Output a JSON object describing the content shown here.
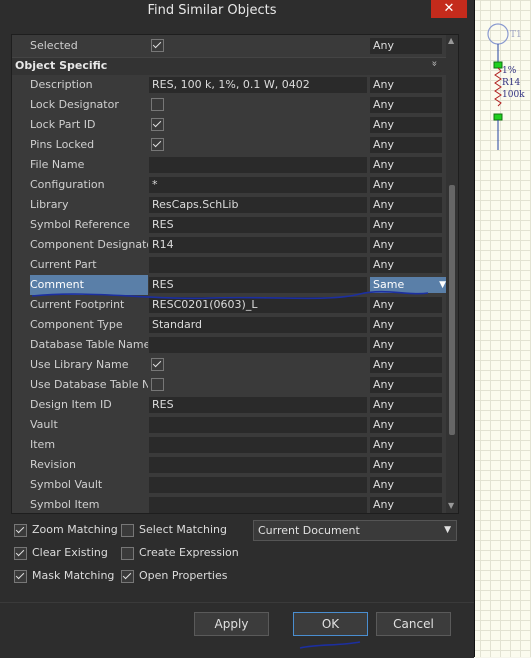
{
  "dialog": {
    "title": "Find Similar Objects",
    "close_glyph": "✕"
  },
  "top_row": {
    "name": "Selected",
    "checked": true,
    "op": "Any"
  },
  "section": {
    "label": "Object Specific",
    "chevron": "»"
  },
  "rows": [
    {
      "name": "Description",
      "value": "RES, 100 k, 1%, 0.1 W, 0402",
      "op": "Any",
      "checkbox": false
    },
    {
      "name": "Lock Designator",
      "value": "",
      "op": "Any",
      "checkbox": true,
      "checked": false
    },
    {
      "name": "Lock Part ID",
      "value": "",
      "op": "Any",
      "checkbox": true,
      "checked": true
    },
    {
      "name": "Pins Locked",
      "value": "",
      "op": "Any",
      "checkbox": true,
      "checked": true
    },
    {
      "name": "File Name",
      "value": "",
      "op": "Any",
      "checkbox": false
    },
    {
      "name": "Configuration",
      "value": "*",
      "op": "Any",
      "checkbox": false
    },
    {
      "name": "Library",
      "value": "ResCaps.SchLib",
      "op": "Any",
      "checkbox": false
    },
    {
      "name": "Symbol Reference",
      "value": "RES",
      "op": "Any",
      "checkbox": false
    },
    {
      "name": "Component Designator",
      "value": "R14",
      "op": "Any",
      "checkbox": false
    },
    {
      "name": "Current Part",
      "value": "",
      "op": "Any",
      "checkbox": false
    },
    {
      "name": "Comment",
      "value": "RES",
      "op": "Same",
      "checkbox": false,
      "selected": true
    },
    {
      "name": "Current Footprint",
      "value": "RESC0201(0603)_L",
      "op": "Any",
      "checkbox": false
    },
    {
      "name": "Component Type",
      "value": "Standard",
      "op": "Any",
      "checkbox": false
    },
    {
      "name": "Database Table Name",
      "value": "",
      "op": "Any",
      "checkbox": false
    },
    {
      "name": "Use Library Name",
      "value": "",
      "op": "Any",
      "checkbox": true,
      "checked": true
    },
    {
      "name": "Use Database Table Name",
      "value": "",
      "op": "Any",
      "checkbox": true,
      "checked": false
    },
    {
      "name": "Design Item ID",
      "value": "RES",
      "op": "Any",
      "checkbox": false
    },
    {
      "name": "Vault",
      "value": "",
      "op": "Any",
      "checkbox": false
    },
    {
      "name": "Item",
      "value": "",
      "op": "Any",
      "checkbox": false
    },
    {
      "name": "Revision",
      "value": "",
      "op": "Any",
      "checkbox": false
    },
    {
      "name": "Symbol Vault",
      "value": "",
      "op": "Any",
      "checkbox": false
    },
    {
      "name": "Symbol Item",
      "value": "",
      "op": "Any",
      "checkbox": false
    }
  ],
  "options": {
    "zoom_matching": {
      "label": "Zoom Matching",
      "checked": true
    },
    "select_matching": {
      "label": "Select Matching",
      "checked": false
    },
    "clear_existing": {
      "label": "Clear Existing",
      "checked": true
    },
    "create_expression": {
      "label": "Create Expression",
      "checked": false
    },
    "mask_matching": {
      "label": "Mask Matching",
      "checked": true
    },
    "open_properties": {
      "label": "Open Properties",
      "checked": true
    }
  },
  "scope": {
    "value": "Current Document"
  },
  "buttons": {
    "apply": "Apply",
    "ok": "OK",
    "cancel": "Cancel"
  },
  "schematic": {
    "ref": "R14",
    "value": "100k",
    "tol": "1%",
    "t1": "T1"
  }
}
